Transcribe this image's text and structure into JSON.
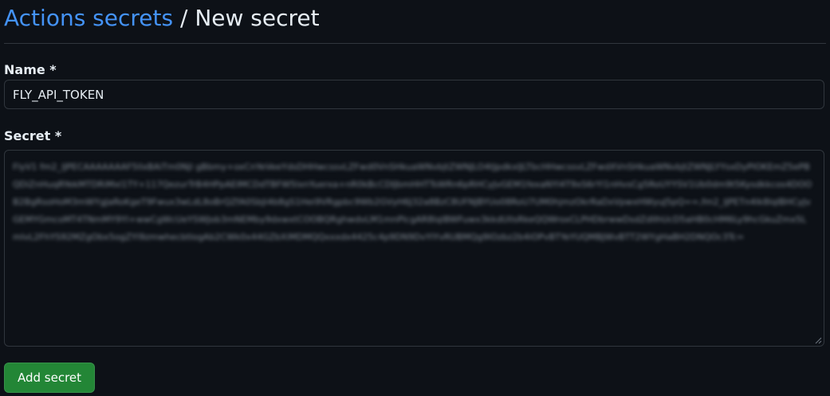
{
  "breadcrumb": {
    "parent_label": "Actions secrets",
    "separator": "/",
    "current_label": "New secret"
  },
  "form": {
    "name_label": "Name *",
    "name_value": "FLY_API_TOKEN",
    "secret_label": "Secret *",
    "secret_value": "FlyV1 fm2_lJPECAAAAAAAF5llxBAiTm0Njl gBbmy+oxCnYeVeeYdsDHHwcssvLZFwd0VnSHkuaWNvbjtZWNJLO4tJpdkxlJLTbcHHwcssvLZFwdXVnSHkuaWNvbjtZWNJLYYsxDyPlOKEmZ5ePBQDiZnHuqRYekMTDRiMxl1TY+117QezurTrB4HPpAEIMCDdTBFW5lxnYuerxa+nR0kBcCDIJbmHHTTsWRn6pRHCyJvGEM1fexaNYl4T9xS6rYl1nHvsCg5RoUYYSV1Ub0dm9t5Kysdkkcos4DOOB2BgRsoHoM3mWYgJaRoKgeT9Fwux3wLdL8oBrQZfA0SbJi4b8gS1Hei9VRgpbc9Wb2GVyH6J32a8BzC8UFNJBYUo08RoU7UM0hjmzOkrRaDxVpwxHWyuJ5pQ==,fm2_lJPETn4lk8lqlBHCyJvGEMYGmcoMT4TNmMY9Yl+wwCgWcUeYSWJob3mNEMby9dxwxtCOOBQRghwdvLM1mnPlcgAR8lqlBWFuwx3kkdUllsRkeQQWroxCLPHDbrwwDsdZdIlhUcD5aHB0cHM6Ly9hcGkuZmx5LmlvL2FhYS92MZgObx5ogZYl9zmwhecbtlogAb2CWk0x44GZbXiMDMQQxxxdx4425c4p9DN9DvYlYvRUBMQg9lOzbz2b4iOPvBTYeYUQMBJWvBTT2WYgHaBH2DNQOc3Tc=",
    "submit_label": "Add secret"
  }
}
